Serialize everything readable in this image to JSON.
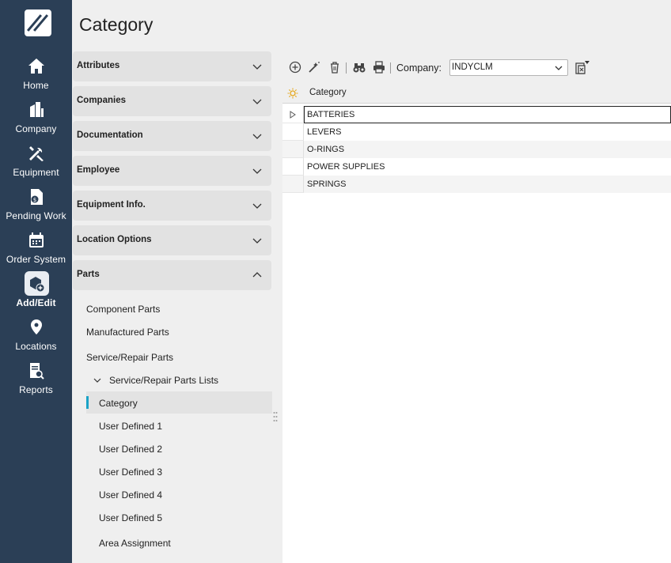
{
  "nav": {
    "items": [
      {
        "label": "Home",
        "icon": "home-icon"
      },
      {
        "label": "Company",
        "icon": "building-icon"
      },
      {
        "label": "Equipment",
        "icon": "tools-icon"
      },
      {
        "label": "Pending Work",
        "icon": "dollar-doc-icon"
      },
      {
        "label": "Order System",
        "icon": "calendar-icon"
      },
      {
        "label": "Add/Edit",
        "icon": "box-plus-icon",
        "active": true
      },
      {
        "label": "Locations",
        "icon": "location-pin-icon"
      },
      {
        "label": "Reports",
        "icon": "report-search-icon"
      }
    ]
  },
  "page": {
    "title": "Category"
  },
  "accordion": {
    "sections": [
      {
        "label": "Attributes"
      },
      {
        "label": "Companies"
      },
      {
        "label": "Documentation"
      },
      {
        "label": "Employee"
      },
      {
        "label": "Equipment Info."
      },
      {
        "label": "Location Options"
      },
      {
        "label": "Parts",
        "expanded": true
      }
    ],
    "parts_items": {
      "component": "Component Parts",
      "manufactured": "Manufactured Parts",
      "service_repair": "Service/Repair Parts",
      "lists": "Service/Repair Parts Lists",
      "category": "Category",
      "ud1": "User Defined 1",
      "ud2": "User Defined 2",
      "ud3": "User Defined 3",
      "ud4": "User Defined 4",
      "ud5": "User Defined 5",
      "area": "Area Assignment"
    }
  },
  "toolbar": {
    "company_label": "Company:",
    "company_value": "INDYCLM",
    "icons": [
      "add-icon",
      "wand-icon",
      "trash-icon",
      "binoculars-icon",
      "printer-icon",
      "export-icon"
    ]
  },
  "grid": {
    "column": "Category",
    "rows": [
      "BATTERIES",
      "LEVERS",
      "O-RINGS",
      "POWER SUPPLIES",
      "SPRINGS"
    ]
  },
  "colors": {
    "rail": "#2b3f56",
    "accent": "#1aa3c7",
    "panel": "#e2e2e2"
  }
}
